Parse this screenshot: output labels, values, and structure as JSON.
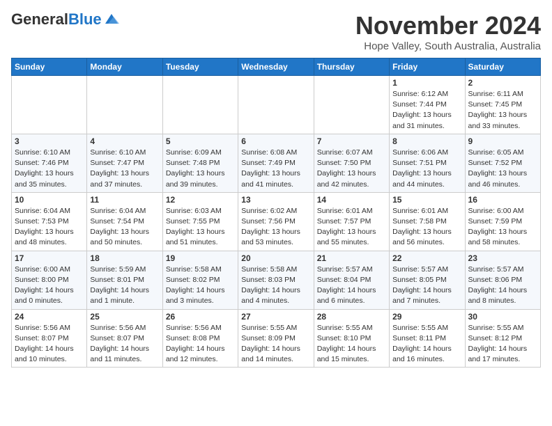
{
  "header": {
    "logo_general": "General",
    "logo_blue": "Blue",
    "month_title": "November 2024",
    "location": "Hope Valley, South Australia, Australia"
  },
  "weekdays": [
    "Sunday",
    "Monday",
    "Tuesday",
    "Wednesday",
    "Thursday",
    "Friday",
    "Saturday"
  ],
  "weeks": [
    [
      {
        "day": "",
        "info": ""
      },
      {
        "day": "",
        "info": ""
      },
      {
        "day": "",
        "info": ""
      },
      {
        "day": "",
        "info": ""
      },
      {
        "day": "",
        "info": ""
      },
      {
        "day": "1",
        "info": "Sunrise: 6:12 AM\nSunset: 7:44 PM\nDaylight: 13 hours and 31 minutes."
      },
      {
        "day": "2",
        "info": "Sunrise: 6:11 AM\nSunset: 7:45 PM\nDaylight: 13 hours and 33 minutes."
      }
    ],
    [
      {
        "day": "3",
        "info": "Sunrise: 6:10 AM\nSunset: 7:46 PM\nDaylight: 13 hours and 35 minutes."
      },
      {
        "day": "4",
        "info": "Sunrise: 6:10 AM\nSunset: 7:47 PM\nDaylight: 13 hours and 37 minutes."
      },
      {
        "day": "5",
        "info": "Sunrise: 6:09 AM\nSunset: 7:48 PM\nDaylight: 13 hours and 39 minutes."
      },
      {
        "day": "6",
        "info": "Sunrise: 6:08 AM\nSunset: 7:49 PM\nDaylight: 13 hours and 41 minutes."
      },
      {
        "day": "7",
        "info": "Sunrise: 6:07 AM\nSunset: 7:50 PM\nDaylight: 13 hours and 42 minutes."
      },
      {
        "day": "8",
        "info": "Sunrise: 6:06 AM\nSunset: 7:51 PM\nDaylight: 13 hours and 44 minutes."
      },
      {
        "day": "9",
        "info": "Sunrise: 6:05 AM\nSunset: 7:52 PM\nDaylight: 13 hours and 46 minutes."
      }
    ],
    [
      {
        "day": "10",
        "info": "Sunrise: 6:04 AM\nSunset: 7:53 PM\nDaylight: 13 hours and 48 minutes."
      },
      {
        "day": "11",
        "info": "Sunrise: 6:04 AM\nSunset: 7:54 PM\nDaylight: 13 hours and 50 minutes."
      },
      {
        "day": "12",
        "info": "Sunrise: 6:03 AM\nSunset: 7:55 PM\nDaylight: 13 hours and 51 minutes."
      },
      {
        "day": "13",
        "info": "Sunrise: 6:02 AM\nSunset: 7:56 PM\nDaylight: 13 hours and 53 minutes."
      },
      {
        "day": "14",
        "info": "Sunrise: 6:01 AM\nSunset: 7:57 PM\nDaylight: 13 hours and 55 minutes."
      },
      {
        "day": "15",
        "info": "Sunrise: 6:01 AM\nSunset: 7:58 PM\nDaylight: 13 hours and 56 minutes."
      },
      {
        "day": "16",
        "info": "Sunrise: 6:00 AM\nSunset: 7:59 PM\nDaylight: 13 hours and 58 minutes."
      }
    ],
    [
      {
        "day": "17",
        "info": "Sunrise: 6:00 AM\nSunset: 8:00 PM\nDaylight: 14 hours and 0 minutes."
      },
      {
        "day": "18",
        "info": "Sunrise: 5:59 AM\nSunset: 8:01 PM\nDaylight: 14 hours and 1 minute."
      },
      {
        "day": "19",
        "info": "Sunrise: 5:58 AM\nSunset: 8:02 PM\nDaylight: 14 hours and 3 minutes."
      },
      {
        "day": "20",
        "info": "Sunrise: 5:58 AM\nSunset: 8:03 PM\nDaylight: 14 hours and 4 minutes."
      },
      {
        "day": "21",
        "info": "Sunrise: 5:57 AM\nSunset: 8:04 PM\nDaylight: 14 hours and 6 minutes."
      },
      {
        "day": "22",
        "info": "Sunrise: 5:57 AM\nSunset: 8:05 PM\nDaylight: 14 hours and 7 minutes."
      },
      {
        "day": "23",
        "info": "Sunrise: 5:57 AM\nSunset: 8:06 PM\nDaylight: 14 hours and 8 minutes."
      }
    ],
    [
      {
        "day": "24",
        "info": "Sunrise: 5:56 AM\nSunset: 8:07 PM\nDaylight: 14 hours and 10 minutes."
      },
      {
        "day": "25",
        "info": "Sunrise: 5:56 AM\nSunset: 8:07 PM\nDaylight: 14 hours and 11 minutes."
      },
      {
        "day": "26",
        "info": "Sunrise: 5:56 AM\nSunset: 8:08 PM\nDaylight: 14 hours and 12 minutes."
      },
      {
        "day": "27",
        "info": "Sunrise: 5:55 AM\nSunset: 8:09 PM\nDaylight: 14 hours and 14 minutes."
      },
      {
        "day": "28",
        "info": "Sunrise: 5:55 AM\nSunset: 8:10 PM\nDaylight: 14 hours and 15 minutes."
      },
      {
        "day": "29",
        "info": "Sunrise: 5:55 AM\nSunset: 8:11 PM\nDaylight: 14 hours and 16 minutes."
      },
      {
        "day": "30",
        "info": "Sunrise: 5:55 AM\nSunset: 8:12 PM\nDaylight: 14 hours and 17 minutes."
      }
    ]
  ]
}
